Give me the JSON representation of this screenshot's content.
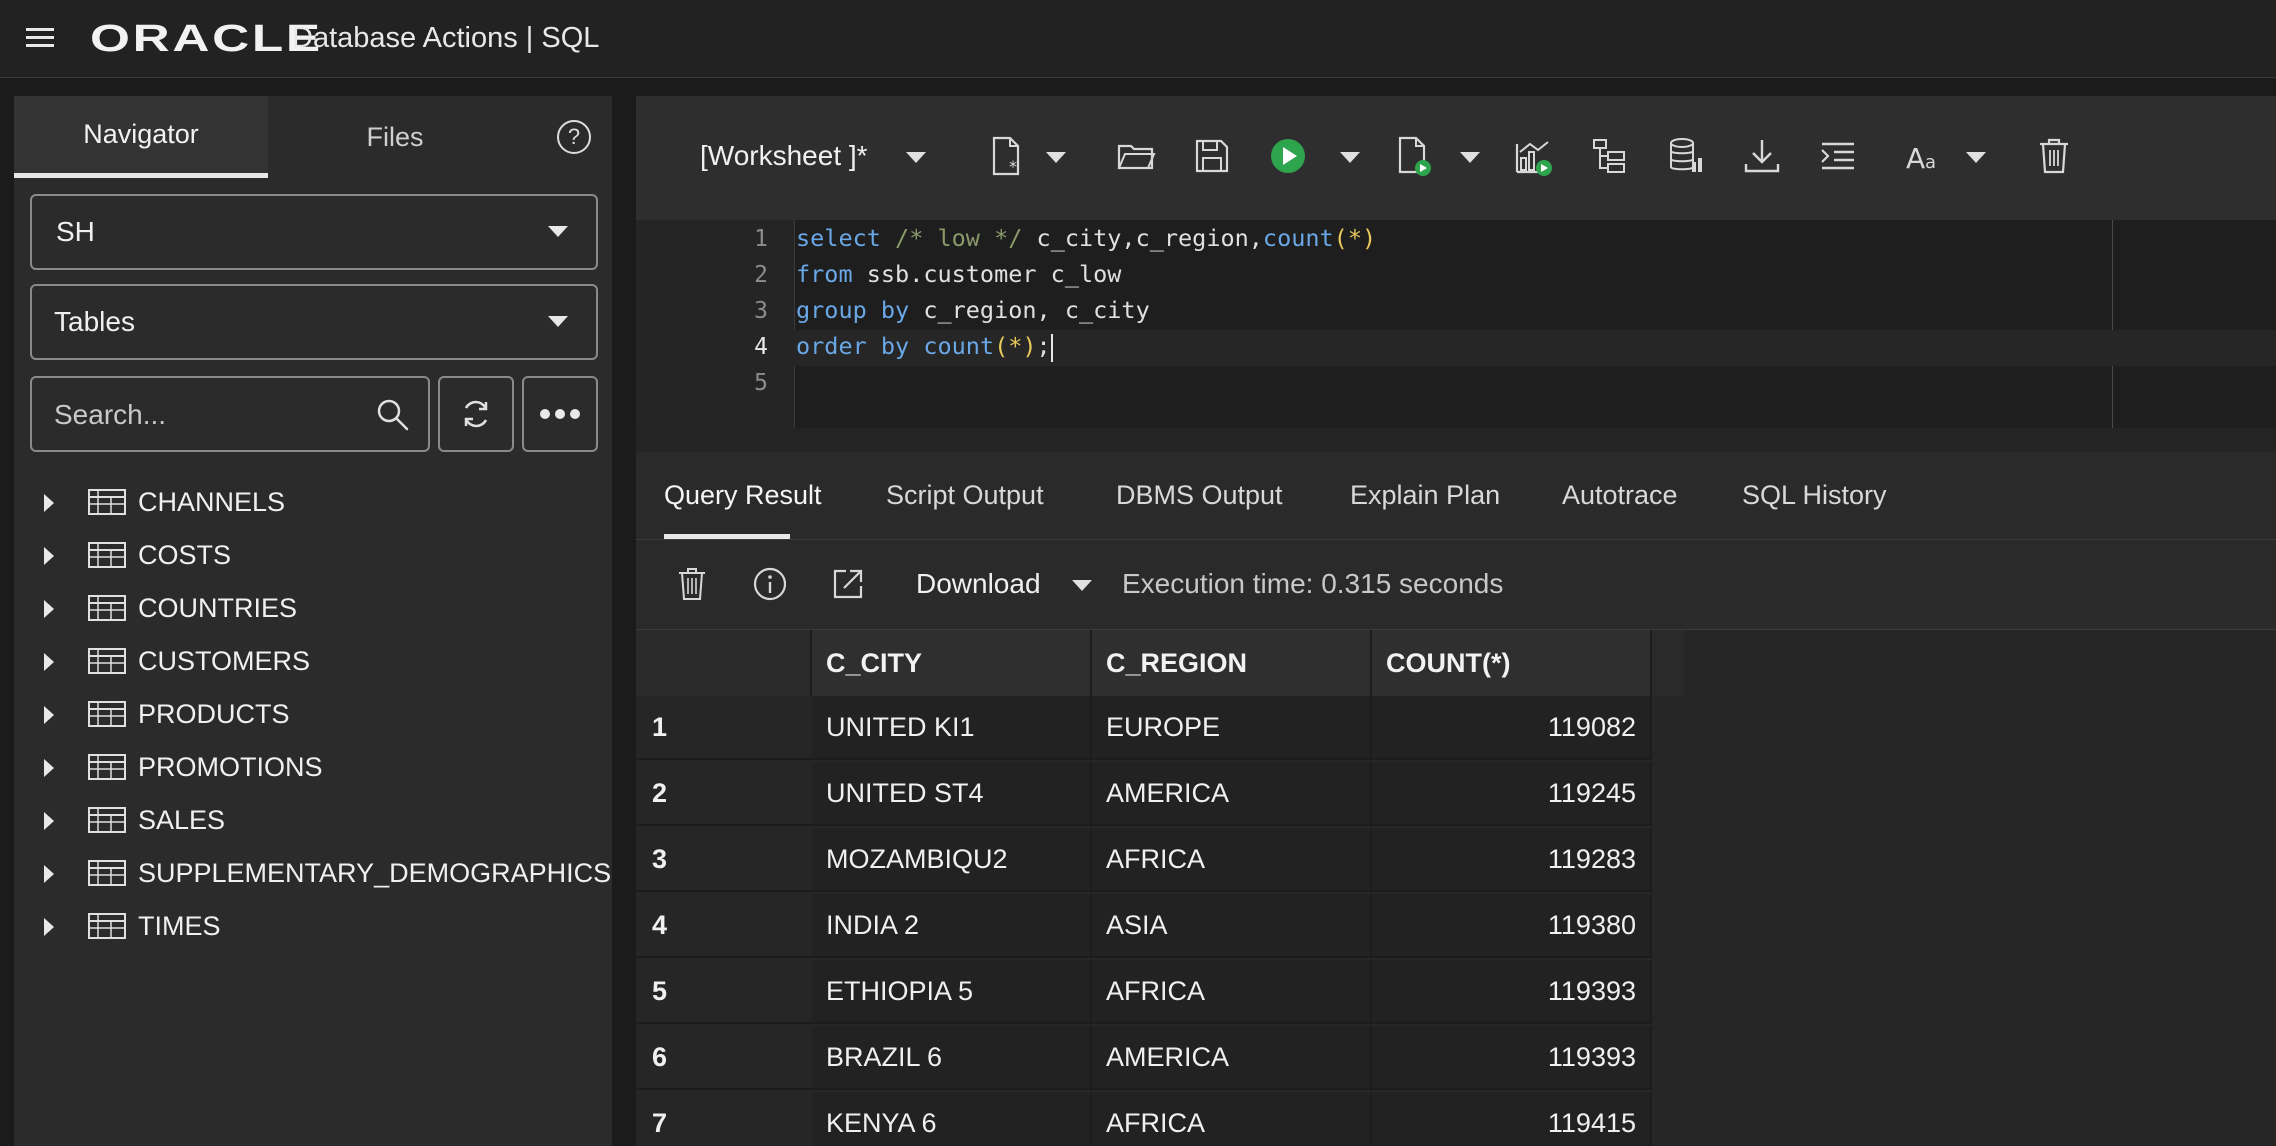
{
  "header": {
    "logo_text": "ORACLE",
    "app_title": "Database Actions |  SQL"
  },
  "navigator": {
    "tabs": [
      {
        "label": "Navigator",
        "active": true
      },
      {
        "label": "Files",
        "active": false
      }
    ],
    "help_label": "?",
    "schema_select": "SH",
    "object_type_select": "Tables",
    "search_placeholder": "Search...",
    "tree_items": [
      {
        "label": "CHANNELS"
      },
      {
        "label": "COSTS"
      },
      {
        "label": "COUNTRIES"
      },
      {
        "label": "CUSTOMERS"
      },
      {
        "label": "PRODUCTS"
      },
      {
        "label": "PROMOTIONS"
      },
      {
        "label": "SALES"
      },
      {
        "label": "SUPPLEMENTARY_DEMOGRAPHICS"
      },
      {
        "label": "TIMES"
      }
    ]
  },
  "worksheet": {
    "title": "[Worksheet ]*",
    "line_numbers": [
      "1",
      "2",
      "3",
      "4",
      "5"
    ],
    "active_line": "4",
    "code": {
      "line1": {
        "k1": "select",
        "c1": "/* low */",
        "t1": "c_city,c_region,",
        "f1": "count",
        "o1": "(*)"
      },
      "line2": {
        "k1": "from",
        "t1": "ssb.customer c_low"
      },
      "line3": {
        "k1": "group by",
        "t1": "c_region, c_city"
      },
      "line4": {
        "k1": "order by",
        "f1": "count",
        "o1": "(*)",
        "t1": ";"
      }
    }
  },
  "results": {
    "tabs": [
      {
        "label": "Query Result",
        "active": true
      },
      {
        "label": "Script Output",
        "active": false
      },
      {
        "label": "DBMS Output",
        "active": false
      },
      {
        "label": "Explain Plan",
        "active": false
      },
      {
        "label": "Autotrace",
        "active": false
      },
      {
        "label": "SQL History",
        "active": false
      }
    ],
    "download_label": "Download",
    "execution_time": "Execution time: 0.315 seconds",
    "columns": [
      "C_CITY",
      "C_REGION",
      "COUNT(*)"
    ],
    "rows": [
      {
        "n": "1",
        "city": "UNITED KI1",
        "region": "EUROPE",
        "count": "119082"
      },
      {
        "n": "2",
        "city": "UNITED ST4",
        "region": "AMERICA",
        "count": "119245"
      },
      {
        "n": "3",
        "city": "MOZAMBIQU2",
        "region": "AFRICA",
        "count": "119283"
      },
      {
        "n": "4",
        "city": "INDIA 2",
        "region": "ASIA",
        "count": "119380"
      },
      {
        "n": "5",
        "city": "ETHIOPIA 5",
        "region": "AFRICA",
        "count": "119393"
      },
      {
        "n": "6",
        "city": "BRAZIL 6",
        "region": "AMERICA",
        "count": "119393"
      },
      {
        "n": "7",
        "city": "KENYA 6",
        "region": "AFRICA",
        "count": "119415"
      }
    ]
  },
  "colors": {
    "run_green": "#2ea44f",
    "keyword_blue": "#6aa7e6",
    "comment_green": "#8a9a6a",
    "paren_yellow": "#e8c85a"
  }
}
